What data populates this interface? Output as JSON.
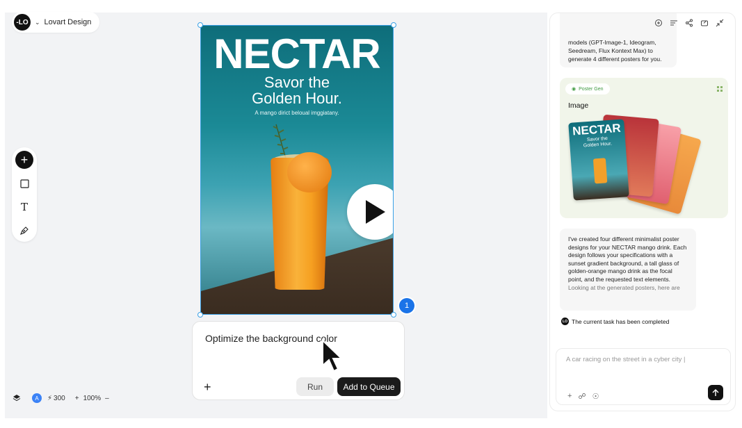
{
  "project": {
    "name": "Lovart Design",
    "logo_text": "-LO"
  },
  "toolbar": {
    "add_icon": "plus-icon",
    "shape_icon": "square-icon",
    "text_icon": "text-icon",
    "pen_icon": "pen-icon"
  },
  "poster": {
    "title": "NECTAR",
    "subtitle_line1": "Savor the",
    "subtitle_line2": "Golden Hour.",
    "tagline": "A mango dirict beloual imggiatany."
  },
  "selection_badge": "1",
  "prompt": {
    "text": "Optimize the background color",
    "run_label": "Run",
    "queue_label": "Add to Queue"
  },
  "status": {
    "avatar": "A",
    "credits": "300",
    "zoom": "100%"
  },
  "chat": {
    "first_message": "models (GPT-Image-1, Ideogram, Seedream, Flux Kontext Max) to generate 4 different posters for you.",
    "tool_tag": "Poster Gen",
    "card_title": "Image",
    "card_poster_title": "NECTAR",
    "card_poster_sub": "Savor the Golden Hour.",
    "main_message": "I've created four different minimalist poster designs for your NECTAR mango drink. Each design follows your specifications with a sunset gradient background, a tall glass of golden-orange mango drink as the focal point, and the requested text elements.",
    "main_message_tail": "Looking at the generated posters, here are",
    "complete_text": "The current task has been completed",
    "input_value": "A car racing on the street in a cyber city |"
  },
  "colors": {
    "accent_blue": "#1a73e8",
    "selection": "#3aa0e6",
    "tag_green": "#3f9a40",
    "dark": "#111111"
  }
}
